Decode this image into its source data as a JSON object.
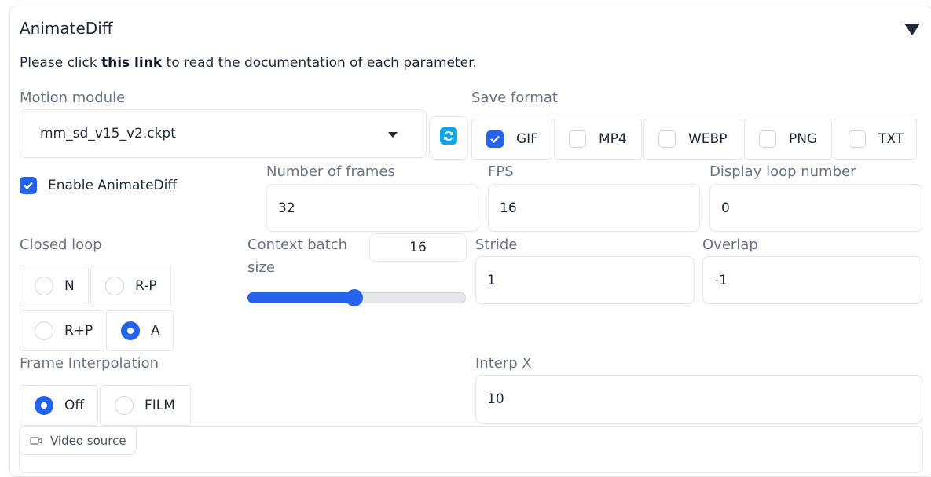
{
  "accordion": {
    "title": "AnimateDiff",
    "doc_prefix": "Please click ",
    "doc_link": "this link",
    "doc_suffix": " to read the documentation of each parameter."
  },
  "motion_module": {
    "label": "Motion module",
    "value": "mm_sd_v15_v2.ckpt"
  },
  "save_format": {
    "label": "Save format",
    "options": [
      {
        "label": "GIF",
        "checked": true
      },
      {
        "label": "MP4",
        "checked": false
      },
      {
        "label": "WEBP",
        "checked": false
      },
      {
        "label": "PNG",
        "checked": false
      },
      {
        "label": "TXT",
        "checked": false
      }
    ]
  },
  "enable": {
    "label": "Enable AnimateDiff",
    "checked": true
  },
  "number_of_frames": {
    "label": "Number of frames",
    "value": "32"
  },
  "fps": {
    "label": "FPS",
    "value": "16"
  },
  "display_loop": {
    "label": "Display loop number",
    "value": "0"
  },
  "closed_loop": {
    "label": "Closed loop",
    "options": [
      "N",
      "R-P",
      "R+P",
      "A"
    ],
    "selected": "A"
  },
  "context_batch": {
    "label_line1": "Context batch",
    "label_line2": "size",
    "value": "16",
    "min": 1,
    "max": 32
  },
  "stride": {
    "label": "Stride",
    "value": "1"
  },
  "overlap": {
    "label": "Overlap",
    "value": "-1"
  },
  "frame_interpolation": {
    "label": "Frame Interpolation",
    "options": [
      "Off",
      "FILM"
    ],
    "selected": "Off"
  },
  "interp_x": {
    "label": "Interp X",
    "value": "10"
  },
  "video_source": {
    "label": "Video source"
  },
  "colors": {
    "accent": "#2563eb",
    "border": "#e5e7eb",
    "label": "#6b7280"
  }
}
